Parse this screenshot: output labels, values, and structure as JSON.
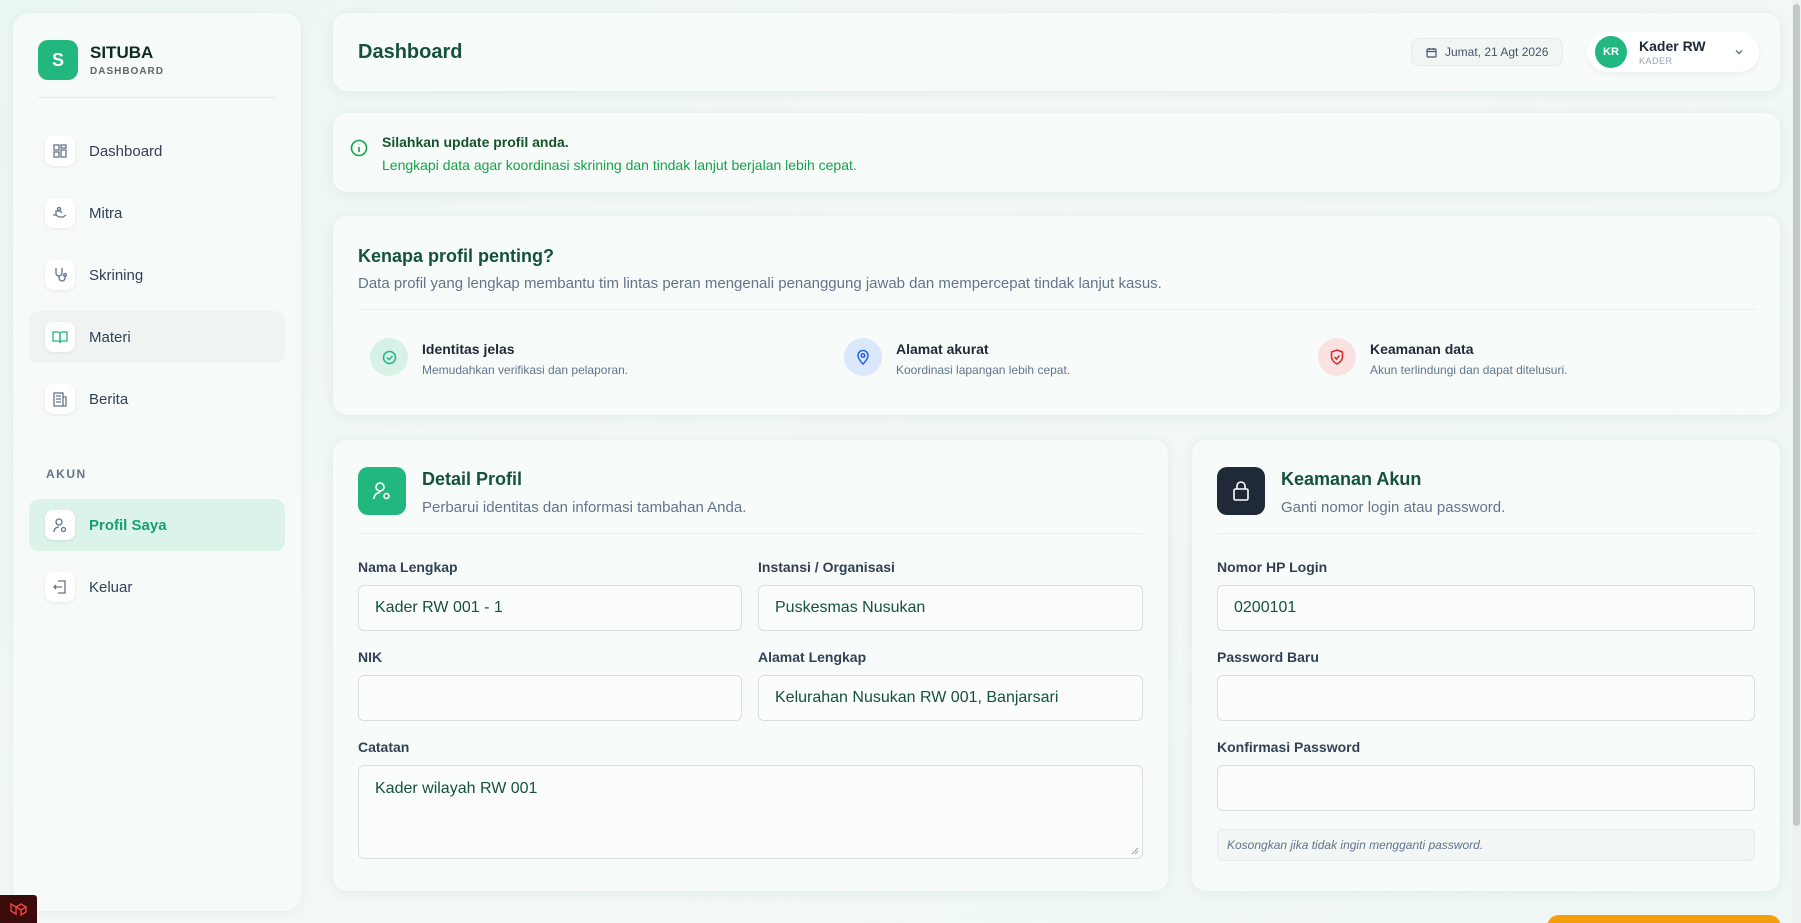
{
  "brand": {
    "logo_letter": "S",
    "name": "SITUBA",
    "subtitle": "DASHBOARD",
    "color": "#22b77f"
  },
  "sidebar": {
    "items": [
      {
        "label": "Dashboard",
        "icon": "grid-icon"
      },
      {
        "label": "Mitra",
        "icon": "handshake-icon"
      },
      {
        "label": "Skrining",
        "icon": "stethoscope-icon"
      },
      {
        "label": "Materi",
        "icon": "book-icon"
      },
      {
        "label": "Berita",
        "icon": "newspaper-icon"
      }
    ],
    "section_label": "AKUN",
    "account_items": [
      {
        "label": "Profil Saya",
        "icon": "user-gear-icon",
        "active": true
      },
      {
        "label": "Keluar",
        "icon": "logout-icon"
      }
    ]
  },
  "header": {
    "title": "Dashboard",
    "date": "Jumat, 21 Agt 2026",
    "user": {
      "initials": "KR",
      "name": "Kader RW",
      "role": "KADER"
    }
  },
  "alert": {
    "title": "Silahkan update profil anda.",
    "text": "Lengkapi data agar koordinasi skrining dan tindak lanjut berjalan lebih cepat."
  },
  "why": {
    "title": "Kenapa profil penting?",
    "description": "Data profil yang lengkap membantu tim lintas peran mengenali penanggung jawab dan mempercepat tindak lanjut kasus.",
    "features": [
      {
        "title": "Identitas jelas",
        "desc": "Memudahkan verifikasi dan pelaporan.",
        "icon": "check-circle-icon",
        "color": "#22b77f"
      },
      {
        "title": "Alamat akurat",
        "desc": "Koordinasi lapangan lebih cepat.",
        "icon": "map-pin-icon",
        "color": "#2563eb"
      },
      {
        "title": "Keamanan data",
        "desc": "Akun terlindungi dan dapat ditelusuri.",
        "icon": "shield-check-icon",
        "color": "#dc2626"
      }
    ]
  },
  "detail": {
    "title": "Detail Profil",
    "description": "Perbarui identitas dan informasi tambahan Anda.",
    "fields": {
      "nama": {
        "label": "Nama Lengkap",
        "value": "Kader RW 001 - 1"
      },
      "instansi": {
        "label": "Instansi / Organisasi",
        "value": "Puskesmas Nusukan"
      },
      "nik": {
        "label": "NIK",
        "value": ""
      },
      "alamat": {
        "label": "Alamat Lengkap",
        "value": "Kelurahan Nusukan RW 001, Banjarsari"
      },
      "catatan": {
        "label": "Catatan",
        "value": "Kader wilayah RW 001"
      }
    }
  },
  "security": {
    "title": "Keamanan Akun",
    "description": "Ganti nomor login atau password.",
    "fields": {
      "phone": {
        "label": "Nomor HP Login",
        "value": "0200101"
      },
      "password": {
        "label": "Password Baru",
        "value": ""
      },
      "confirm": {
        "label": "Konfirmasi Password",
        "value": ""
      }
    },
    "hint": "Kosongkan jika tidak ingin mengganti password."
  },
  "colors": {
    "accent": "#22b77f",
    "heading": "#14523b",
    "warning": "#f59e0b",
    "dark_icon_bg": "#1f2937"
  }
}
